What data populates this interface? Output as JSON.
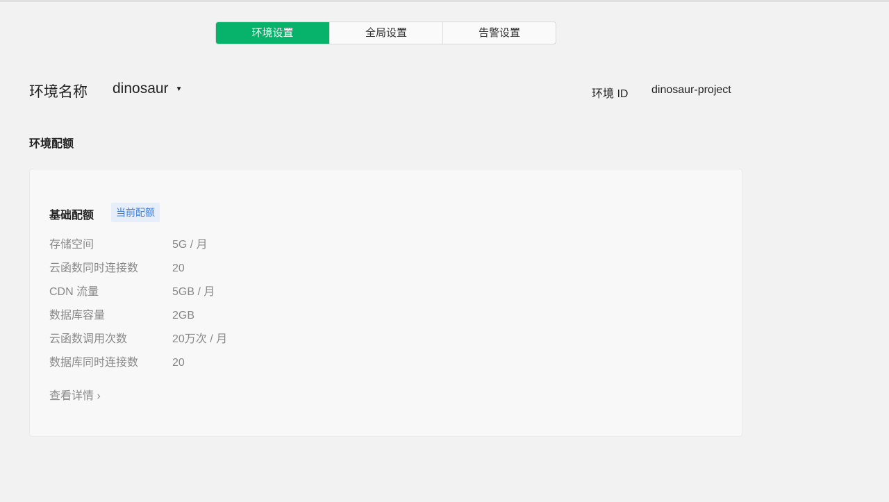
{
  "tabs": [
    "环境设置",
    "全局设置",
    "告警设置"
  ],
  "env": {
    "label": "环境名称",
    "name": "dinosaur",
    "id_label": "环境 ID",
    "id": "dinosaur-project"
  },
  "section_title": "环境配额",
  "card": {
    "title": "基础配额",
    "badge": "当前配额",
    "rows": [
      {
        "k": "存储空间",
        "v": "5G / 月"
      },
      {
        "k": "云函数同时连接数",
        "v": "20"
      },
      {
        "k": "CDN 流量",
        "v": "5GB / 月"
      },
      {
        "k": "数据库容量",
        "v": "2GB"
      },
      {
        "k": "云函数调用次数",
        "v": "20万次 / 月"
      },
      {
        "k": "数据库同时连接数",
        "v": "20"
      }
    ],
    "more": "查看详情"
  },
  "colors": {
    "accent": "#07b36b",
    "badge": "#3d7de3"
  }
}
